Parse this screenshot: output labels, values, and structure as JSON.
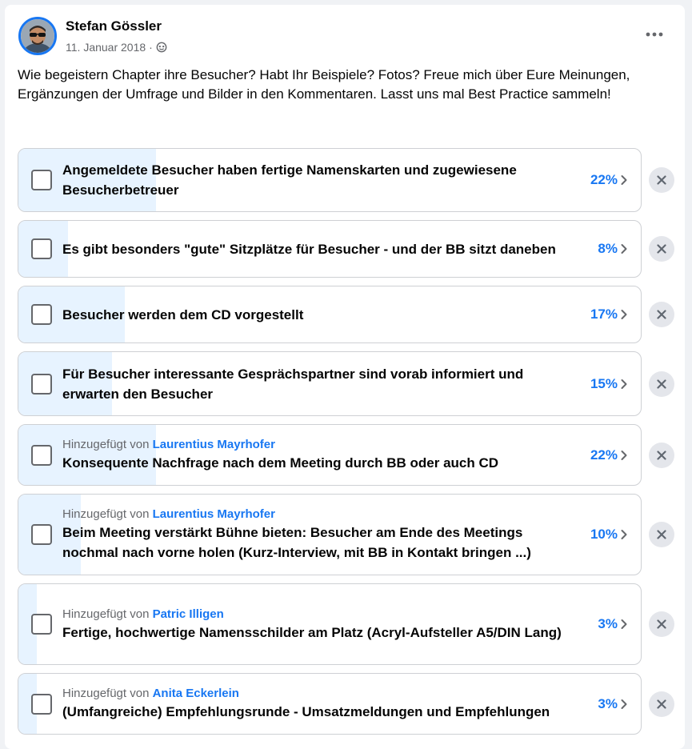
{
  "post": {
    "author": "Stefan Gössler",
    "date": "11. Januar 2018",
    "separator": "·",
    "text": "Wie begeistern Chapter ihre Besucher? Habt Ihr Beispiele? Fotos? Freue mich über Eure Meinungen, Ergänzungen der Umfrage und Bilder in den Kommentaren. Lasst uns mal Best Practice sammeln!"
  },
  "icons": {
    "globe": "globe-icon",
    "more": "more-options-icon",
    "chevron": "chevron-right-icon",
    "remove": "close-icon"
  },
  "colors": {
    "accent": "#1877f2",
    "fill": "#e7f3ff",
    "border": "#ced0d4",
    "secondary_text": "#65676b"
  },
  "poll": {
    "added_prefix": "Hinzugefügt von",
    "options": [
      {
        "label": "Angemeldete Besucher haben fertige Namenskarten und zugewiesene Besucherbetreuer",
        "percent": "22%",
        "fraction": 0.22,
        "added_by": null
      },
      {
        "label": "Es gibt besonders \"gute\" Sitzplätze für Besucher - und der BB sitzt daneben",
        "percent": "8%",
        "fraction": 0.08,
        "added_by": null
      },
      {
        "label": "Besucher werden dem CD vorgestellt",
        "percent": "17%",
        "fraction": 0.17,
        "added_by": null
      },
      {
        "label": "Für Besucher interessante Gesprächspartner sind vorab informiert und erwarten den Besucher",
        "percent": "15%",
        "fraction": 0.15,
        "added_by": null
      },
      {
        "label": "Konsequente Nachfrage nach dem Meeting durch BB oder auch CD",
        "percent": "22%",
        "fraction": 0.22,
        "added_by": "Laurentius Mayrhofer"
      },
      {
        "label": "Beim Meeting verstärkt Bühne bieten: Besucher am Ende des Meetings nochmal nach vorne holen (Kurz-Interview, mit BB in Kontakt bringen ...)",
        "percent": "10%",
        "fraction": 0.1,
        "added_by": "Laurentius Mayrhofer"
      },
      {
        "label": "Fertige, hochwertige Namensschilder am Platz (Acryl-Aufsteller A5/DIN Lang)",
        "percent": "3%",
        "fraction": 0.03,
        "added_by": "Patric Illigen"
      },
      {
        "label": "(Umfangreiche) Empfehlungsrunde - Umsatzmeldungen und Empfehlungen",
        "percent": "3%",
        "fraction": 0.03,
        "added_by": "Anita Eckerlein"
      }
    ]
  }
}
